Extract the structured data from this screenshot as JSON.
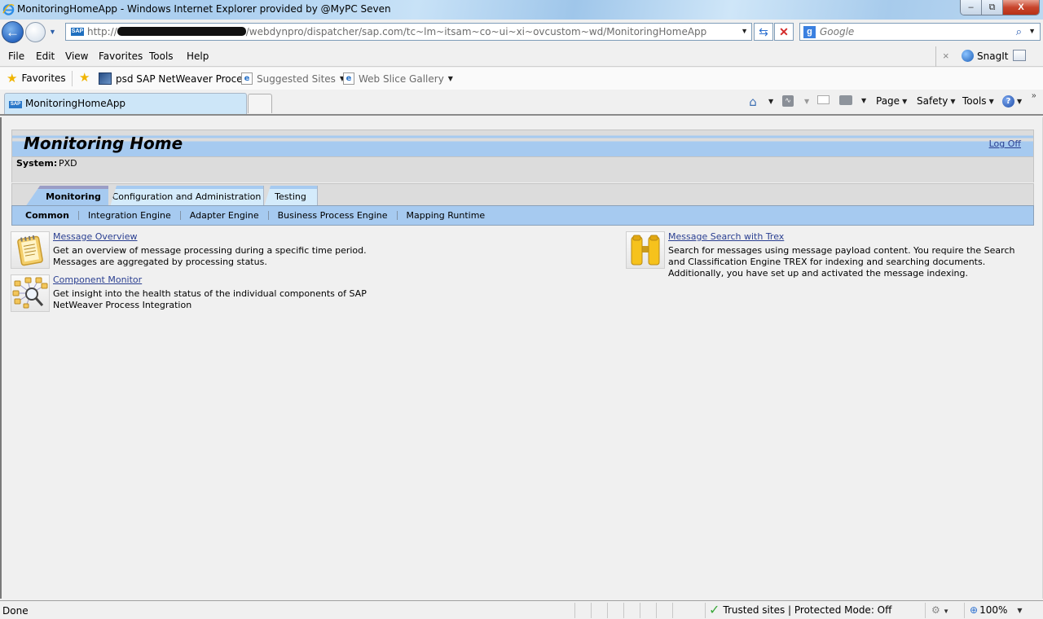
{
  "window": {
    "title": "MonitoringHomeApp - Windows Internet Explorer provided by @MyPC Seven",
    "controls": {
      "minimize": "–",
      "restore": "⧉",
      "close": "X"
    }
  },
  "address_bar": {
    "url_prefix": "http://",
    "url_suffix": "/webdynpro/dispatcher/sap.com/tc~lm~itsam~co~ui~xi~ovcustom~wd/MonitoringHomeApp",
    "favicon": "SAP",
    "refresh_icon": "⇆",
    "stop_icon": "✕"
  },
  "search": {
    "engine_icon": "g",
    "placeholder": "Google"
  },
  "menu": {
    "items": [
      "File",
      "Edit",
      "View",
      "Favorites",
      "Tools",
      "Help"
    ],
    "close_toolbar": "×",
    "snagit_label": "SnagIt"
  },
  "favorites_bar": {
    "favorites_label": "Favorites",
    "items": [
      {
        "label": "psd SAP NetWeaver Proce..."
      },
      {
        "label": "Suggested Sites",
        "has_dropdown": true
      },
      {
        "label": "Web Slice Gallery",
        "has_dropdown": true
      }
    ]
  },
  "browser_tabs": [
    {
      "title": "MonitoringHomeApp",
      "active": true
    }
  ],
  "command_bar": {
    "page": "Page",
    "safety": "Safety",
    "tools": "Tools",
    "help": "?",
    "more": "»"
  },
  "app": {
    "title": "Monitoring Home",
    "logoff": "Log Off",
    "system_label": "System:",
    "system_value": "PXD",
    "tabs": [
      {
        "label": "Monitoring",
        "active": true
      },
      {
        "label": "Configuration and Administration",
        "active": false
      },
      {
        "label": "Testing",
        "active": false
      }
    ],
    "subnav": [
      {
        "label": "Common",
        "active": true
      },
      {
        "label": "Integration Engine",
        "active": false
      },
      {
        "label": "Adapter Engine",
        "active": false
      },
      {
        "label": "Business Process Engine",
        "active": false
      },
      {
        "label": "Mapping Runtime",
        "active": false
      }
    ],
    "tiles": [
      {
        "title": "Message Overview",
        "description": "Get an overview of message processing during a specific time period. Messages are aggregated by processing status.",
        "icon": "notepad-icon"
      },
      {
        "title": "Component Monitor",
        "description": "Get insight into the health status of the individual components of SAP NetWeaver Process Integration",
        "icon": "network-magnifier-icon"
      },
      {
        "title": "Message Search with Trex",
        "description": "Search for messages using message payload content.  You require the Search and Classification Engine TREX for indexing and searching documents. Additionally, you have set up and activated the message indexing.",
        "icon": "binoculars-icon"
      }
    ]
  },
  "status_bar": {
    "status": "Done",
    "zone": "Trusted sites | Protected Mode: Off",
    "zoom": "100%"
  }
}
